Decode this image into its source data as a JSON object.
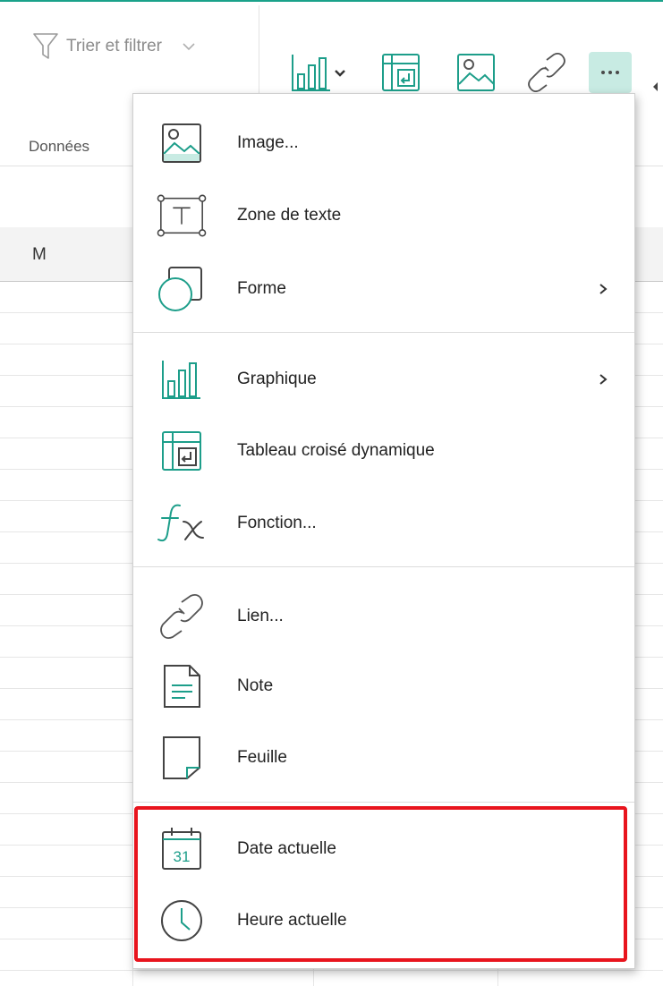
{
  "ribbon": {
    "sort_filter_label": "Trier et filtrer",
    "group_label": "Données",
    "toolbar": [
      "chart-icon",
      "pivot-table-icon",
      "image-icon",
      "link-icon",
      "more-icon"
    ],
    "accent_color": "#1aa28a"
  },
  "sheet": {
    "column_letter": "M"
  },
  "menu": {
    "items": [
      {
        "label": "Image...",
        "icon": "image-icon"
      },
      {
        "label": "Zone de texte",
        "icon": "text-box-icon"
      },
      {
        "label": "Forme",
        "icon": "shape-icon",
        "submenu": true
      },
      {
        "label": "Graphique",
        "icon": "chart-icon",
        "submenu": true
      },
      {
        "label": "Tableau croisé dynamique",
        "icon": "pivot-table-icon"
      },
      {
        "label": "Fonction...",
        "icon": "function-icon"
      },
      {
        "label": "Lien...",
        "icon": "link-icon"
      },
      {
        "label": "Note",
        "icon": "note-icon"
      },
      {
        "label": "Feuille",
        "icon": "sheet-icon"
      },
      {
        "label": "Date actuelle",
        "icon": "calendar-icon",
        "calendar_number": "31"
      },
      {
        "label": "Heure actuelle",
        "icon": "clock-icon"
      }
    ],
    "highlight_color": "#e8141d"
  }
}
